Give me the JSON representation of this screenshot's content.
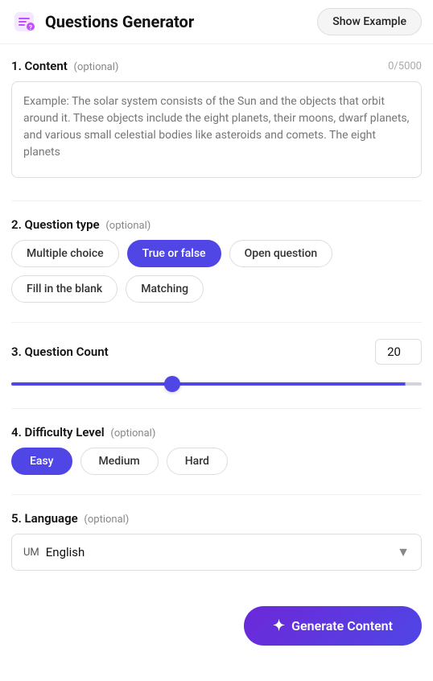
{
  "header": {
    "title": "Questions Generator",
    "show_example_label": "Show Example",
    "icon_label": "questions-generator-icon"
  },
  "sections": {
    "content": {
      "label": "1. Content",
      "optional_label": "(optional)",
      "char_count": "0/5000",
      "placeholder": "Example: The solar system consists of the Sun and the objects that orbit around it. These objects include the eight planets, their moons, dwarf planets, and various small celestial bodies like asteroids and comets. The eight planets"
    },
    "question_type": {
      "label": "2. Question type",
      "optional_label": "(optional)",
      "options": [
        {
          "id": "multiple-choice",
          "label": "Multiple choice",
          "active": false
        },
        {
          "id": "true-or-false",
          "label": "True or false",
          "active": true
        },
        {
          "id": "open-question",
          "label": "Open question",
          "active": false
        },
        {
          "id": "fill-in-the-blank",
          "label": "Fill in the blank",
          "active": false
        },
        {
          "id": "matching",
          "label": "Matching",
          "active": false
        }
      ]
    },
    "question_count": {
      "label": "3. Question Count",
      "value": 20,
      "min": 1,
      "max": 50
    },
    "difficulty": {
      "label": "4. Difficulty Level",
      "optional_label": "(optional)",
      "options": [
        {
          "id": "easy",
          "label": "Easy",
          "active": true
        },
        {
          "id": "medium",
          "label": "Medium",
          "active": false
        },
        {
          "id": "hard",
          "label": "Hard",
          "active": false
        }
      ]
    },
    "language": {
      "label": "5. Language",
      "optional_label": "(optional)",
      "current_flag": "UM",
      "current_language": "English"
    }
  },
  "generate_button": {
    "label": "Generate Content"
  }
}
